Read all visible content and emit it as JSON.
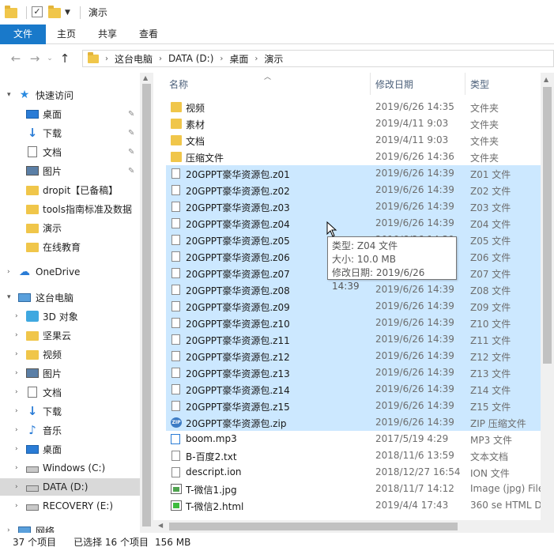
{
  "window": {
    "title": "演示"
  },
  "ribbon": {
    "tabs": [
      "文件",
      "主页",
      "共享",
      "查看"
    ]
  },
  "address": {
    "crumbs": [
      "这台电脑",
      "DATA (D:)",
      "桌面",
      "演示"
    ]
  },
  "nav": {
    "quick_access": "快速访问",
    "quick_items": [
      {
        "label": "桌面",
        "icon": "desktop-icon",
        "pinned": true
      },
      {
        "label": "下载",
        "icon": "download-icon",
        "pinned": true
      },
      {
        "label": "文档",
        "icon": "document-icon",
        "pinned": true
      },
      {
        "label": "图片",
        "icon": "picture-icon",
        "pinned": true
      },
      {
        "label": "dropit【已备稿】",
        "icon": "folder-icon",
        "pinned": false
      },
      {
        "label": "tools指南标准及数据",
        "icon": "folder-icon",
        "pinned": false
      },
      {
        "label": "演示",
        "icon": "folder-icon",
        "pinned": false
      },
      {
        "label": "在线教育",
        "icon": "folder-icon",
        "pinned": false
      }
    ],
    "onedrive": "OneDrive",
    "this_pc": "这台电脑",
    "pc_items": [
      {
        "label": "3D 对象",
        "icon": "3d-objects-icon"
      },
      {
        "label": "坚果云",
        "icon": "folder-icon"
      },
      {
        "label": "视频",
        "icon": "video-icon"
      },
      {
        "label": "图片",
        "icon": "picture-icon"
      },
      {
        "label": "文档",
        "icon": "document-icon"
      },
      {
        "label": "下载",
        "icon": "download-icon"
      },
      {
        "label": "音乐",
        "icon": "music-icon"
      },
      {
        "label": "桌面",
        "icon": "desktop-icon"
      },
      {
        "label": "Windows (C:)",
        "icon": "drive-icon"
      },
      {
        "label": "DATA (D:)",
        "icon": "drive-icon",
        "selected": true
      },
      {
        "label": "RECOVERY (E:)",
        "icon": "drive-icon"
      }
    ],
    "network": "网络"
  },
  "columns": {
    "name": "名称",
    "date": "修改日期",
    "type": "类型"
  },
  "files": [
    {
      "name": "视频",
      "date": "2019/6/26 14:35",
      "type": "文件夹",
      "icon": "folder",
      "selected": false
    },
    {
      "name": "素材",
      "date": "2019/4/11 9:03",
      "type": "文件夹",
      "icon": "folder",
      "selected": false
    },
    {
      "name": "文档",
      "date": "2019/4/11 9:03",
      "type": "文件夹",
      "icon": "folder",
      "selected": false
    },
    {
      "name": "压缩文件",
      "date": "2019/6/26 14:36",
      "type": "文件夹",
      "icon": "folder",
      "selected": false
    },
    {
      "name": "20GPPT豪华资源包.z01",
      "date": "2019/6/26 14:39",
      "type": "Z01 文件",
      "icon": "file",
      "selected": true
    },
    {
      "name": "20GPPT豪华资源包.z02",
      "date": "2019/6/26 14:39",
      "type": "Z02 文件",
      "icon": "file",
      "selected": true
    },
    {
      "name": "20GPPT豪华资源包.z03",
      "date": "2019/6/26 14:39",
      "type": "Z03 文件",
      "icon": "file",
      "selected": true
    },
    {
      "name": "20GPPT豪华资源包.z04",
      "date": "2019/6/26 14:39",
      "type": "Z04 文件",
      "icon": "file",
      "selected": true
    },
    {
      "name": "20GPPT豪华资源包.z05",
      "date": "2019/6/26 14:39",
      "type": "Z05 文件",
      "icon": "file",
      "selected": true
    },
    {
      "name": "20GPPT豪华资源包.z06",
      "date": "2019/6/26 14:39",
      "type": "Z06 文件",
      "icon": "file",
      "selected": true
    },
    {
      "name": "20GPPT豪华资源包.z07",
      "date": "2019/6/26 14:39",
      "type": "Z07 文件",
      "icon": "file",
      "selected": true
    },
    {
      "name": "20GPPT豪华资源包.z08",
      "date": "2019/6/26 14:39",
      "type": "Z08 文件",
      "icon": "file",
      "selected": true
    },
    {
      "name": "20GPPT豪华资源包.z09",
      "date": "2019/6/26 14:39",
      "type": "Z09 文件",
      "icon": "file",
      "selected": true
    },
    {
      "name": "20GPPT豪华资源包.z10",
      "date": "2019/6/26 14:39",
      "type": "Z10 文件",
      "icon": "file",
      "selected": true
    },
    {
      "name": "20GPPT豪华资源包.z11",
      "date": "2019/6/26 14:39",
      "type": "Z11 文件",
      "icon": "file",
      "selected": true
    },
    {
      "name": "20GPPT豪华资源包.z12",
      "date": "2019/6/26 14:39",
      "type": "Z12 文件",
      "icon": "file",
      "selected": true
    },
    {
      "name": "20GPPT豪华资源包.z13",
      "date": "2019/6/26 14:39",
      "type": "Z13 文件",
      "icon": "file",
      "selected": true
    },
    {
      "name": "20GPPT豪华资源包.z14",
      "date": "2019/6/26 14:39",
      "type": "Z14 文件",
      "icon": "file",
      "selected": true
    },
    {
      "name": "20GPPT豪华资源包.z15",
      "date": "2019/6/26 14:39",
      "type": "Z15 文件",
      "icon": "file",
      "selected": true
    },
    {
      "name": "20GPPT豪华资源包.zip",
      "date": "2019/6/26 14:39",
      "type": "ZIP 压缩文件",
      "icon": "zip",
      "selected": true
    },
    {
      "name": "boom.mp3",
      "date": "2017/5/19 4:29",
      "type": "MP3 文件",
      "icon": "mp3",
      "selected": false
    },
    {
      "name": "B-百度2.txt",
      "date": "2018/11/6 13:59",
      "type": "文本文档",
      "icon": "file",
      "selected": false
    },
    {
      "name": "descript.ion",
      "date": "2018/12/27 16:54",
      "type": "ION 文件",
      "icon": "file",
      "selected": false
    },
    {
      "name": "T-微信1.jpg",
      "date": "2018/11/7 14:12",
      "type": "Image (jpg) File",
      "icon": "image",
      "selected": false
    },
    {
      "name": "T-微信2.html",
      "date": "2019/4/4 17:43",
      "type": "360 se HTML D",
      "icon": "html",
      "selected": false
    }
  ],
  "tooltip": {
    "type_line": "类型: Z04 文件",
    "size_line": "大小: 10.0 MB",
    "date_line": "修改日期: 2019/6/26 14:39"
  },
  "status": {
    "count": "37 个项目",
    "selected": "已选择 16 个项目",
    "size": "156 MB"
  },
  "colors": {
    "accent": "#1979ca",
    "selection": "#cce8ff",
    "folder": "#f0c64a"
  }
}
